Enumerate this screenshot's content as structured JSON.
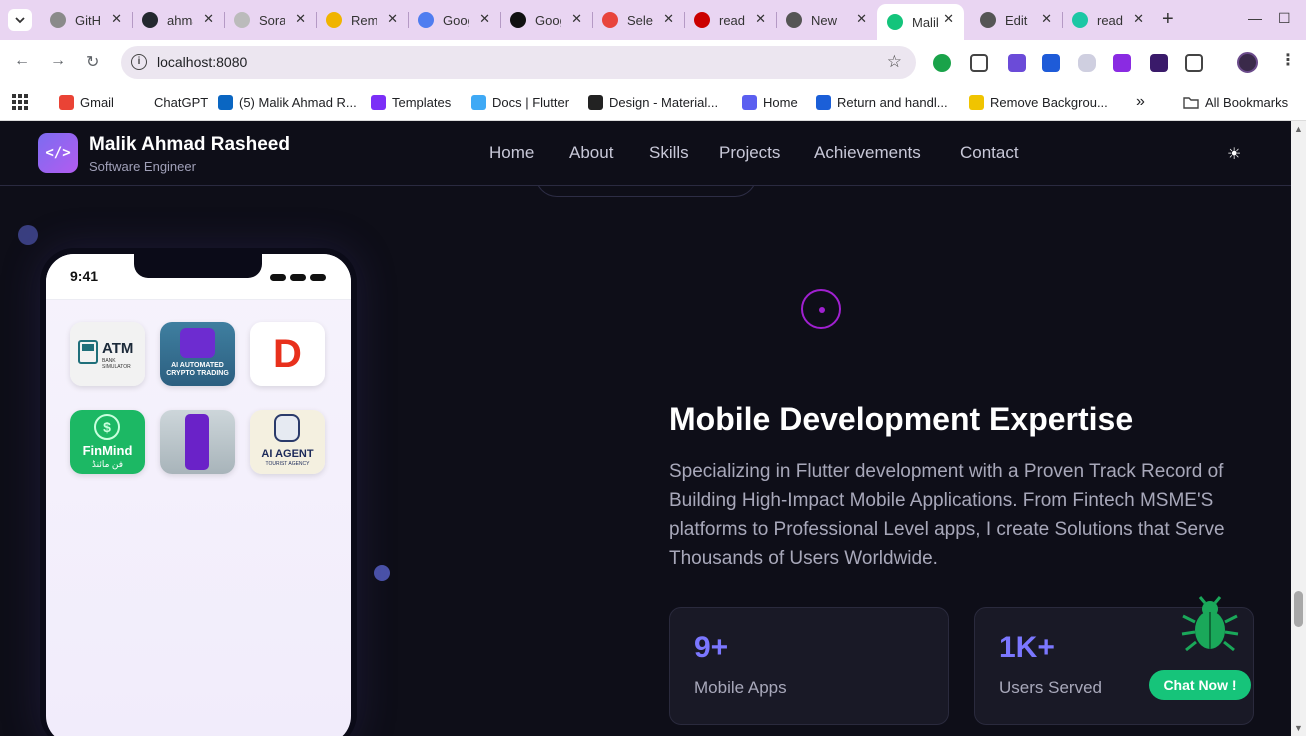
{
  "browser": {
    "tabs": [
      {
        "label": "GitHub",
        "favicon": "github-icon",
        "color": "#8a8a8a"
      },
      {
        "label": "ahmad",
        "favicon": "github-icon",
        "color": "#24292f"
      },
      {
        "label": "Sora",
        "favicon": "sora-icon",
        "color": "#bbbbbb"
      },
      {
        "label": "Remove",
        "favicon": "remove-bg-icon",
        "color": "#f0b400"
      },
      {
        "label": "Google",
        "favicon": "gemini-icon",
        "color": "#4f7df0"
      },
      {
        "label": "Google",
        "favicon": "github-icon",
        "color": "#111111"
      },
      {
        "label": "Select",
        "favicon": "google-apps-icon",
        "color": "#e8453c"
      },
      {
        "label": "readme",
        "favicon": "npm-icon",
        "color": "#cb0000"
      },
      {
        "label": "New",
        "favicon": "chrome-icon",
        "color": "#555555"
      },
      {
        "label": "Malik",
        "favicon": "flutter-icon",
        "color": "#14c47b",
        "active": true
      },
      {
        "label": "Edit",
        "favicon": "github-icon",
        "color": "#555555"
      },
      {
        "label": "readme",
        "favicon": "readme-icon",
        "color": "#1cc7a5"
      }
    ],
    "url": "localhost:8080",
    "bookmarks": [
      {
        "label": "Gmail",
        "favicon": "gmail-icon",
        "color": "#ea4335"
      },
      {
        "label": "ChatGPT",
        "favicon": "chatgpt-icon",
        "color": "#ffffff"
      },
      {
        "label": "(5) Malik Ahmad R...",
        "favicon": "linkedin-icon",
        "color": "#0a66c2"
      },
      {
        "label": "Templates",
        "favicon": "templates-icon",
        "color": "#7b2ff7"
      },
      {
        "label": "Docs | Flutter",
        "favicon": "flutter-icon",
        "color": "#3fa9f5"
      },
      {
        "label": "Design - Material...",
        "favicon": "material-icon",
        "color": "#222222"
      },
      {
        "label": "Home",
        "favicon": "home-icon",
        "color": "#5b5ff0"
      },
      {
        "label": "Return and handl...",
        "favicon": "return-icon",
        "color": "#1b5fd8"
      },
      {
        "label": "Remove Backgrou...",
        "favicon": "remove-bg-icon",
        "color": "#f0c400"
      }
    ],
    "more_bookmarks": "»",
    "all_bookmarks": "All Bookmarks"
  },
  "site": {
    "brand": {
      "name": "Malik Ahmad Rasheed",
      "role": "Software Engineer",
      "logo": "</>"
    },
    "nav": [
      "Home",
      "About",
      "Skills",
      "Projects",
      "Achievements",
      "Contact"
    ],
    "phone": {
      "time": "9:41",
      "apps": [
        {
          "name": "ATM",
          "caption": "BANK SIMULATOR",
          "bg": "#f2f2f2",
          "fg": "#1f6f7a"
        },
        {
          "name": "",
          "caption": "AI AUTOMATED CRYPTO TRADING",
          "bg": "#4f8aa8",
          "fg": "#ffffff"
        },
        {
          "name": "D",
          "caption": "",
          "bg": "#ffffff",
          "fg": "#e8301c"
        },
        {
          "name": "FinMind",
          "caption": "فن مائنڈ",
          "bg": "#1cb864",
          "fg": "#ffffff"
        },
        {
          "name": "",
          "caption": "",
          "bg": "#bfcad0",
          "fg": "#6a22c8"
        },
        {
          "name": "AI AGENT",
          "caption": "TOURIST AGENCY",
          "bg": "#f4f0e0",
          "fg": "#1c2a5a"
        }
      ]
    },
    "expertise": {
      "title": "Mobile Development Expertise",
      "description": "Specializing in Flutter development with a Proven Track Record of Building High-Impact Mobile Applications. From Fintech MSME'S platforms to Professional Level apps, I create Solutions that Serve Thousands of Users Worldwide.",
      "stats": [
        {
          "value": "9+",
          "label": "Mobile Apps"
        },
        {
          "value": "1K+",
          "label": "Users Served"
        }
      ]
    },
    "chat_button": "Chat Now !",
    "colors": {
      "accent": "#7b77ff",
      "chat": "#16c47a",
      "ring": "#a020d0"
    }
  }
}
